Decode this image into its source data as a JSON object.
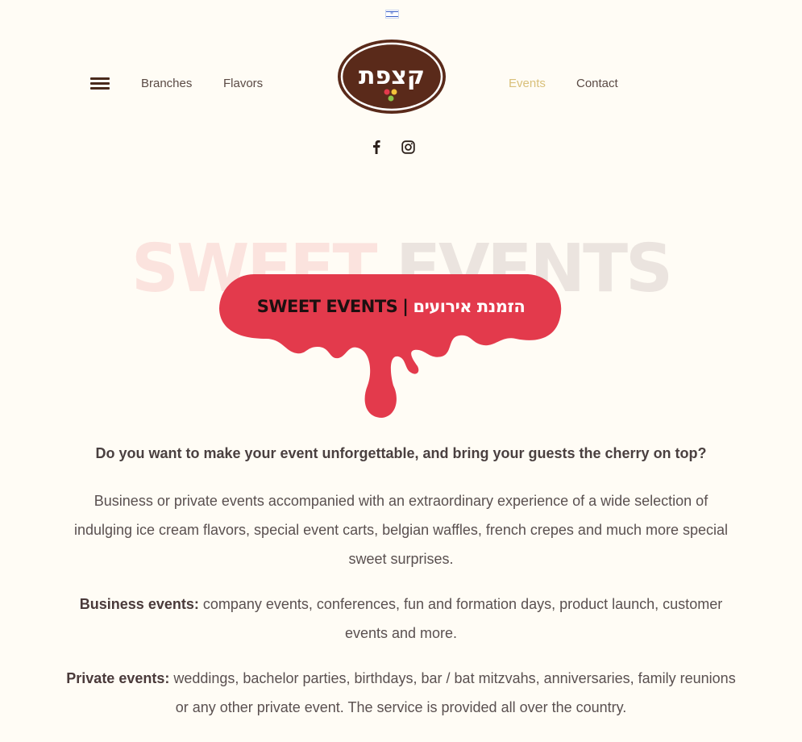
{
  "header": {
    "language_flag": "israel-flag-icon",
    "nav_left": [
      "Branches",
      "Flavors"
    ],
    "nav_right": [
      "Events",
      "Contact"
    ],
    "active_nav": "Events",
    "logo_text": "קצפת",
    "social": [
      "facebook-icon",
      "instagram-icon"
    ]
  },
  "hero": {
    "bg_title_1": "SWEET",
    "bg_title_2": "EVENTS",
    "banner_en": "SWEET EVENTS",
    "banner_sep": "|",
    "banner_he": "הזמנת אירועים"
  },
  "content": {
    "question": "Do you want to make your event unforgettable, and bring your guests the cherry on top?",
    "intro": "Business or private events accompanied with an extraordinary experience of a wide selection of indulging ice cream flavors, special event carts, belgian waffles, french crepes and much more special sweet surprises.",
    "business_label": "Business events:",
    "business_text": " company events, conferences, fun and formation days, product launch, customer events and more.",
    "private_label": "Private events:",
    "private_text": " weddings, bachelor parties, birthdays, bar / bat mitzvahs, anniversaries, family reunions or any other private event. The service is provided all over the country."
  },
  "colors": {
    "background": "#fffcf5",
    "brand_brown": "#5a2a1a",
    "drip_red": "#e33a4c",
    "active_nav": "#d9c07a"
  }
}
